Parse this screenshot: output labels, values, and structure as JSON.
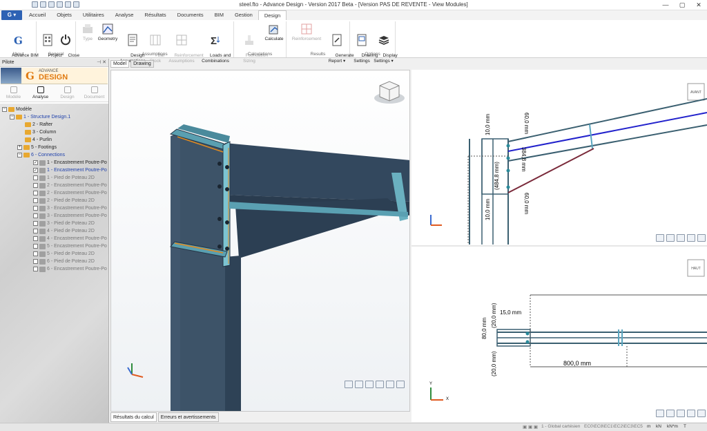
{
  "window": {
    "title": "steel.fto - Advance Design - Version 2017 Beta - [Version PAS DE REVENTE - View Modules]",
    "controls": [
      "—",
      "▢",
      "✕"
    ]
  },
  "app_button": "G ▾",
  "tabs": [
    "Accueil",
    "Objets",
    "Utilitaires",
    "Analyse",
    "Résultats",
    "Documents",
    "BIM",
    "Gestion",
    "Design"
  ],
  "active_tab": "Design",
  "ribbon": {
    "about": {
      "label": "About",
      "btn": "Advance BIM\nDesigners ▾"
    },
    "general": {
      "label": "General",
      "b1": "Project\nSettings",
      "b2": "Close\n▾"
    },
    "assumptions": {
      "label": "Assumptions",
      "b1": "Type",
      "b2": "Geometry",
      "b3": "Design\nAssumptions",
      "b4": "Bar\nStock",
      "b5": "Reinforcement\nAssumptions",
      "b6": "Loads and\nCombinations"
    },
    "calculations": {
      "label": "Calculations",
      "b1": "Foundation\nSizing",
      "b2": "Calculate"
    },
    "results": {
      "label": "Results",
      "b1": "Reinforcement",
      "b2": "Generate\nReport ▾"
    },
    "options": {
      "label": "Options",
      "b1": "Drawing\nSettings",
      "b2": "Display\nSettings ▾"
    }
  },
  "pilot": {
    "title": "Pilote",
    "logo_small": "ADVANCE",
    "logo_big": "DESIGN",
    "modes": [
      "Modèle",
      "Analyse",
      "Design",
      "Document"
    ],
    "tree": {
      "root": "Modèle",
      "structure": "1 - Structure Design.1",
      "n2": "2 - Rafter",
      "n3": "3 - Column",
      "n4": "4 - Purlin",
      "n5": "5 - Footings",
      "n6": "6 - Connections",
      "c1": "1 - Encastrement Poutre-Po",
      "c2": "1 - Encastrement Poutre-Po",
      "c3": "1 - Pied de Poteau 2D",
      "c4": "2 - Encastrement Poutre-Po",
      "c5": "2 - Encastrement Poutre-Po",
      "c6": "2 - Pied de Poteau 2D",
      "c7": "3 - Encastrement Poutre-Po",
      "c8": "3 - Encastrement Poutre-Po",
      "c9": "3 - Pied de Poteau 2D",
      "c10": "4 - Pied de Poteau 2D",
      "c11": "4 - Encastrement Poutre-Po",
      "c12": "5 - Encastrement Poutre-Po",
      "c13": "5 - Pied de Poteau 2D",
      "c14": "6 - Pied de Poteau 2D",
      "c15": "6 - Encastrement Poutre-Po"
    }
  },
  "view_tabs": [
    "Model",
    "Drawing"
  ],
  "bottom_tabs": [
    "Résultats du calcul",
    "Erreurs et avertissements"
  ],
  "drawing": {
    "view_avant": "AVANT",
    "view_haut": "HAUT",
    "d1": "10,0 mm",
    "d2": "60,0 mm",
    "d3": "(484,8 mm)",
    "d4": "384,8 mm",
    "d5": "60,0 mm",
    "d6": "10,0 mm",
    "d7": "15,0 mm",
    "d8": "80,0 mm",
    "d9": "(20,0 mm)",
    "d10": "(20,0 mm)",
    "d11": "800,0 mm",
    "axis_y": "Y",
    "axis_x": "X"
  },
  "status": {
    "s1": "1 - Global cartésien",
    "s2": "EC0\\EC8\\EC1\\EC2\\EC3\\EC5",
    "s3": "m",
    "s4": "kN",
    "s5": "kN*m",
    "s6": "T"
  }
}
